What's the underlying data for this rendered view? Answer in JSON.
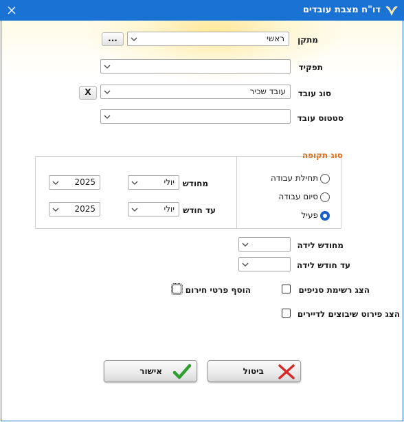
{
  "window": {
    "title": "דו\"ח מצבת עובדים",
    "close_label": "✕"
  },
  "fields": {
    "installer": {
      "label": "מתקן",
      "value": "ראשי",
      "browse_label": "..."
    },
    "role": {
      "label": "תפקיד",
      "value": ""
    },
    "employee_type": {
      "label": "סוג עובד",
      "value": "עובד שכיר",
      "clear_label": "X"
    },
    "employee_status": {
      "label": "סטטוס עובד",
      "value": ""
    }
  },
  "period": {
    "title": "סוג תקופה",
    "options": [
      "תחילת עבודה",
      "סיום עבודה",
      "פעיל"
    ],
    "selected": "פעיל",
    "from_label": "מחודש",
    "to_label": "עד חודש",
    "from_month": "יולי",
    "from_year": "2025",
    "to_month": "יולי",
    "to_year": "2025"
  },
  "birth": {
    "from_label": "מחודש לידה",
    "from_value": "",
    "to_label": "עד חודש לידה",
    "to_value": ""
  },
  "options": {
    "show_branches": {
      "label": "הצג רשימת סניפים",
      "checked": false
    },
    "add_emergency": {
      "label": "הוסף פרטי חירום",
      "checked": false
    },
    "show_assignments": {
      "label": "הצג פירוט שיבוצים לדיירים",
      "checked": false
    }
  },
  "buttons": {
    "ok_label": "אישור",
    "cancel_label": "ביטול"
  },
  "colors": {
    "titlebar": "#1a72d4",
    "accent_orange": "#e0701a",
    "radio_selected": "#1a5fc7",
    "ok_check": "#2e9e2e",
    "cancel_x": "#d42a2a"
  },
  "icons": [
    "app-logo-icon",
    "close-icon",
    "chevron-down-icon",
    "checkmark-icon",
    "x-cross-icon"
  ]
}
